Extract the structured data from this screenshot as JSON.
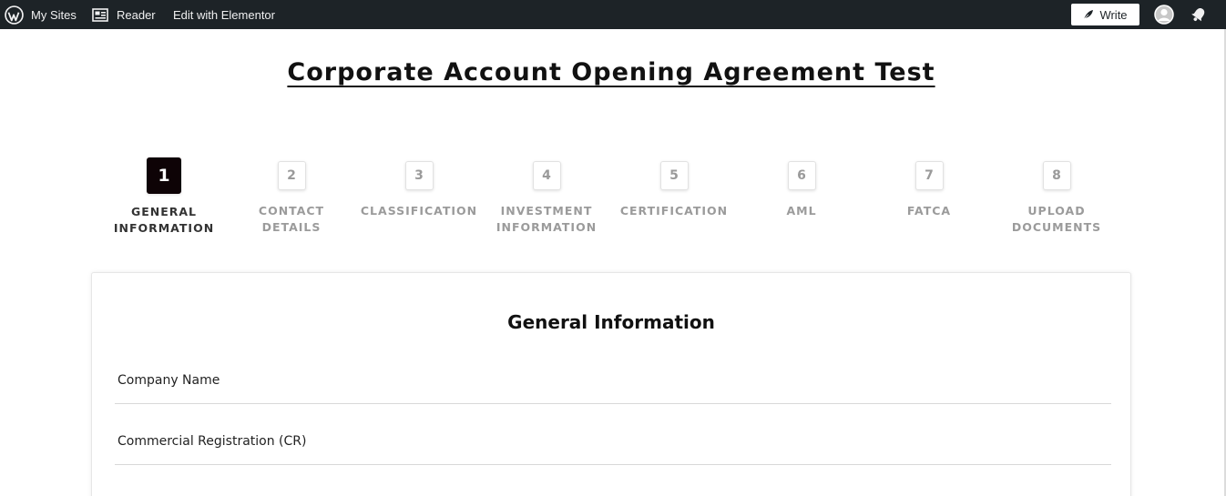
{
  "adminbar": {
    "my_sites": "My Sites",
    "reader": "Reader",
    "edit_elementor": "Edit with Elementor",
    "write": "Write"
  },
  "page": {
    "title": "Corporate Account Opening Agreement Test"
  },
  "steps": [
    {
      "num": "1",
      "line1": "GENERAL",
      "line2": "INFORMATION",
      "active": true
    },
    {
      "num": "2",
      "line1": "CONTACT",
      "line2": "DETAILS"
    },
    {
      "num": "3",
      "line1": "CLASSIFICATION",
      "line2": ""
    },
    {
      "num": "4",
      "line1": "INVESTMENT",
      "line2": "INFORMATION"
    },
    {
      "num": "5",
      "line1": "CERTIFICATION",
      "line2": ""
    },
    {
      "num": "6",
      "line1": "AML",
      "line2": ""
    },
    {
      "num": "7",
      "line1": "FATCA",
      "line2": ""
    },
    {
      "num": "8",
      "line1": "UPLOAD",
      "line2": "DOCUMENTS"
    }
  ],
  "form": {
    "section_title": "General Information",
    "fields": [
      {
        "label": "Company Name"
      },
      {
        "label": "Commercial Registration (CR)"
      }
    ]
  },
  "colors": {
    "adminbar_bg": "#1d2327",
    "active_step_bg": "#0e0306",
    "inactive_step_text": "#9b9b9b"
  }
}
